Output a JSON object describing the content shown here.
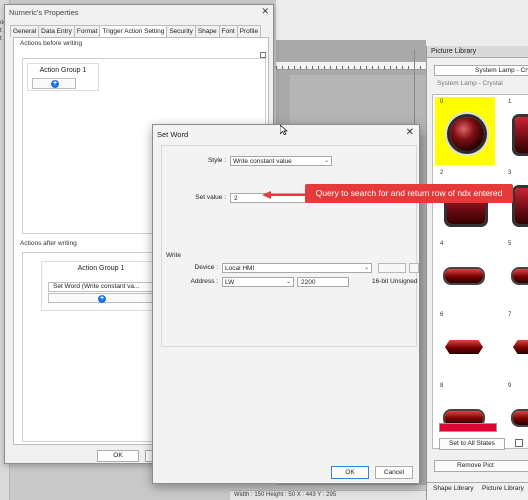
{
  "background_app": {
    "left_labels": [
      "oot",
      "t",
      "t"
    ],
    "status_text": "Width : 150    Height : 50    X : 443    Y : 295"
  },
  "picture_library": {
    "title": "Picture Library",
    "library_selected": "System Lamp - Crysta",
    "library_subtitle": "System Lamp - Crystal",
    "tiles": [
      {
        "num": "0",
        "selected": true,
        "shape": "round"
      },
      {
        "num": "1",
        "selected": false,
        "shape": "square"
      },
      {
        "num": "2",
        "selected": false,
        "shape": "square"
      },
      {
        "num": "3",
        "selected": false,
        "shape": "square"
      },
      {
        "num": "4",
        "selected": false,
        "shape": "pill"
      },
      {
        "num": "5",
        "selected": false,
        "shape": "pill"
      },
      {
        "num": "6",
        "selected": false,
        "shape": "arrow"
      },
      {
        "num": "7",
        "selected": false,
        "shape": "arrow"
      },
      {
        "num": "8",
        "selected": false,
        "shape": "pill"
      },
      {
        "num": "9",
        "selected": false,
        "shape": "pill"
      }
    ],
    "color_value": "#e00030",
    "set_all_states": "Set to All States",
    "checkbox_label": "A",
    "remove_label": "Remove Pict",
    "tab_shape": "Shape Library",
    "tab_picture": "Picture Library"
  },
  "numeric_properties": {
    "title": "Numeric's Properties",
    "close": "✕",
    "tabs": [
      {
        "label": "General",
        "active": false
      },
      {
        "label": "Data Entry",
        "active": false
      },
      {
        "label": "Format",
        "active": false
      },
      {
        "label": "Trigger Action Setting",
        "active": true
      },
      {
        "label": "Security",
        "active": false
      },
      {
        "label": "Shape",
        "active": false
      },
      {
        "label": "Font",
        "active": false
      },
      {
        "label": "Profile",
        "active": false
      }
    ],
    "before_label": "Actions before writing",
    "before_group_title": "Action Group 1",
    "after_label": "Actions after writing",
    "after_group_title": "Action Group 1",
    "after_action": "Set Word (Write constant va...",
    "ok": "OK"
  },
  "set_word": {
    "title": "Set Word",
    "close": "✕",
    "style_label": "Style :",
    "style_value": "Write constant value",
    "set_value_label": "Set value :",
    "set_value": "2",
    "write_label": "Write",
    "device_label": "Device :",
    "device_value": "Local HMI",
    "address_label": "Address :",
    "address_type": "LW",
    "address_value": "2200",
    "data_format": "16-bit Unsigned",
    "ok": "OK",
    "cancel": "Cancel"
  },
  "annotation": {
    "text": "Query to search for and return row of ndx entered",
    "color": "#e63a3a"
  }
}
